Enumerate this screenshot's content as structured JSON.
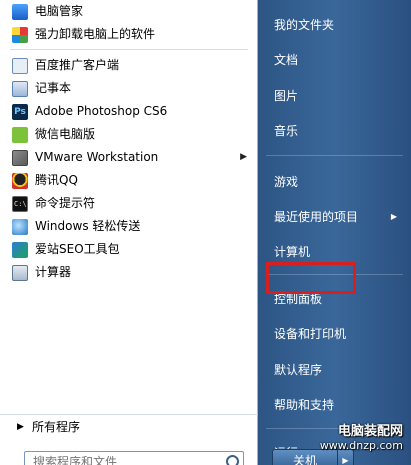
{
  "left_pane": {
    "items": [
      {
        "label": "电脑管家",
        "icon": "tencent-shield-icon",
        "has_submenu": false
      },
      {
        "label": "强力卸载电脑上的软件",
        "icon": "uninstall-icon",
        "has_submenu": false
      },
      {
        "label": "百度推广客户端",
        "icon": "baidu-promotion-icon",
        "has_submenu": false
      },
      {
        "label": "记事本",
        "icon": "notepad-icon",
        "has_submenu": false
      },
      {
        "label": "Adobe Photoshop CS6",
        "icon": "photoshop-icon",
        "has_submenu": false
      },
      {
        "label": "微信电脑版",
        "icon": "wechat-icon",
        "has_submenu": false
      },
      {
        "label": "VMware Workstation",
        "icon": "vmware-icon",
        "has_submenu": true
      },
      {
        "label": "腾讯QQ",
        "icon": "qq-icon",
        "has_submenu": false
      },
      {
        "label": "命令提示符",
        "icon": "command-prompt-icon",
        "has_submenu": false
      },
      {
        "label": "Windows 轻松传送",
        "icon": "easy-transfer-icon",
        "has_submenu": false
      },
      {
        "label": "爱站SEO工具包",
        "icon": "aizhan-seo-icon",
        "has_submenu": false
      },
      {
        "label": "计算器",
        "icon": "calculator-icon",
        "has_submenu": false
      }
    ],
    "all_programs": "所有程序",
    "search_placeholder": "搜索程序和文件"
  },
  "right_pane": {
    "items": [
      {
        "label": "我的文件夹",
        "has_submenu": false
      },
      {
        "label": "文档",
        "has_submenu": false
      },
      {
        "label": "图片",
        "has_submenu": false
      },
      {
        "label": "音乐",
        "has_submenu": false
      },
      {
        "label": "游戏",
        "has_submenu": false
      },
      {
        "label": "最近使用的项目",
        "has_submenu": true
      },
      {
        "label": "计算机",
        "has_submenu": false
      },
      {
        "label": "控制面板",
        "has_submenu": false,
        "highlighted": true
      },
      {
        "label": "设备和打印机",
        "has_submenu": false
      },
      {
        "label": "默认程序",
        "has_submenu": false
      },
      {
        "label": "帮助和支持",
        "has_submenu": false
      },
      {
        "label": "运行...",
        "has_submenu": false
      }
    ],
    "shutdown_label": "关机"
  },
  "watermark": {
    "title": "电脑装配网",
    "url": "www.dnzp.com"
  },
  "colors": {
    "right_pane_bg": "#3a679a",
    "highlight_border": "#d81f1f",
    "left_pane_bg": "#ffffff"
  }
}
